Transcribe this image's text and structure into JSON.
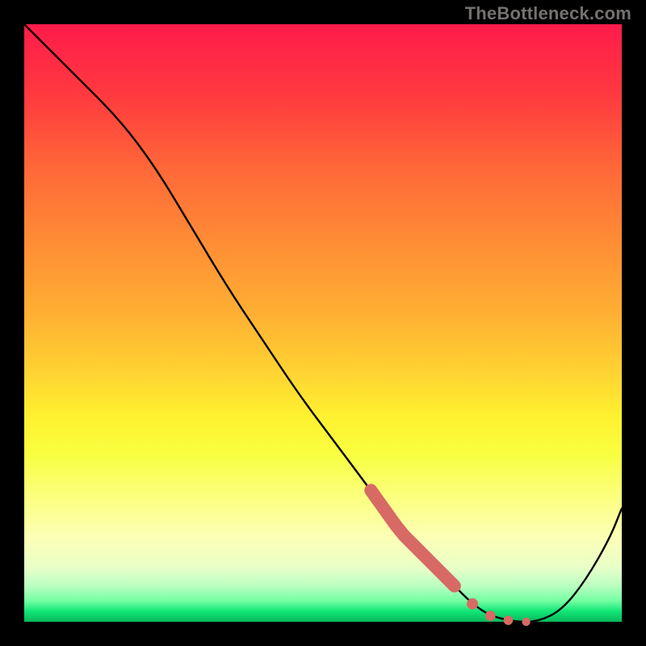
{
  "watermark": "TheBottleneck.com",
  "colors": {
    "background": "#000000",
    "curve": "#000000",
    "highlight": "#d76a65",
    "watermark_text": "#74716f"
  },
  "chart_data": {
    "type": "line",
    "title": "",
    "xlabel": "",
    "ylabel": "",
    "xlim": [
      0,
      100
    ],
    "ylim": [
      0,
      100
    ],
    "gradient_background": {
      "orientation": "vertical",
      "stops": [
        {
          "pos": 0,
          "color": "#ff1b4a"
        },
        {
          "pos": 12,
          "color": "#ff3a3f"
        },
        {
          "pos": 24,
          "color": "#ff6738"
        },
        {
          "pos": 36,
          "color": "#ff8b35"
        },
        {
          "pos": 48,
          "color": "#ffae33"
        },
        {
          "pos": 58,
          "color": "#ffd232"
        },
        {
          "pos": 66,
          "color": "#fff230"
        },
        {
          "pos": 72,
          "color": "#f8ff40"
        },
        {
          "pos": 80,
          "color": "#fcff86"
        },
        {
          "pos": 86,
          "color": "#fcffb6"
        },
        {
          "pos": 91,
          "color": "#e8ffc0"
        },
        {
          "pos": 94,
          "color": "#b9ffc0"
        },
        {
          "pos": 96.5,
          "color": "#74ffa2"
        },
        {
          "pos": 98.2,
          "color": "#12e777"
        },
        {
          "pos": 100,
          "color": "#06b85a"
        }
      ]
    },
    "series": [
      {
        "name": "bottleneck-curve",
        "x": [
          0,
          8,
          16,
          22,
          28,
          34,
          40,
          46,
          52,
          58,
          63,
          68,
          72,
          75,
          78,
          82,
          86,
          90,
          94,
          98,
          100
        ],
        "y": [
          100,
          92,
          84,
          76,
          66,
          56,
          47,
          38,
          30,
          22,
          15,
          10,
          6,
          3,
          1,
          0,
          0,
          2,
          7,
          14,
          19
        ]
      }
    ],
    "highlight": {
      "name": "optimal-region",
      "type": "segment-on-curve",
      "color": "#d76a65",
      "segment_x_range": [
        58,
        72
      ],
      "dots_x": [
        75,
        78,
        81,
        84
      ]
    }
  }
}
